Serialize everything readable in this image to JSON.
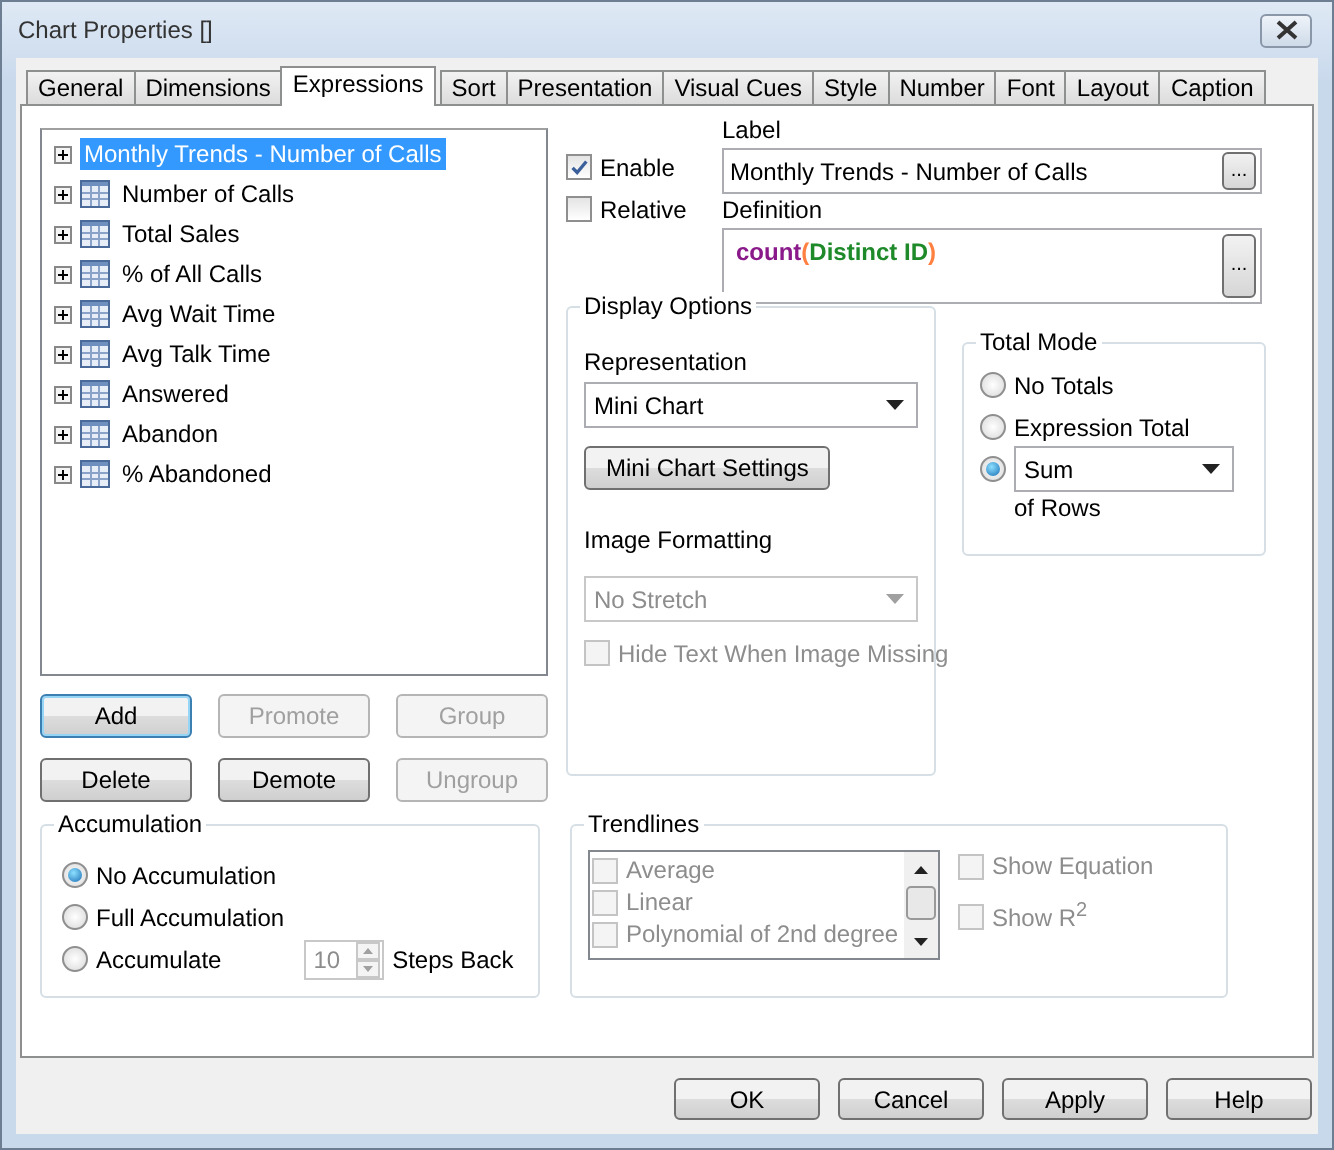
{
  "window": {
    "title": "Chart Properties []"
  },
  "tabs": [
    {
      "label": "General",
      "selected": false
    },
    {
      "label": "Dimensions",
      "selected": false
    },
    {
      "label": "Expressions",
      "selected": true
    },
    {
      "label": "Sort",
      "selected": false
    },
    {
      "label": "Presentation",
      "selected": false
    },
    {
      "label": "Visual Cues",
      "selected": false
    },
    {
      "label": "Style",
      "selected": false
    },
    {
      "label": "Number",
      "selected": false
    },
    {
      "label": "Font",
      "selected": false
    },
    {
      "label": "Layout",
      "selected": false
    },
    {
      "label": "Caption",
      "selected": false
    }
  ],
  "expressions": [
    {
      "label": "Monthly Trends - Number of Calls",
      "kind": "group",
      "selected": true
    },
    {
      "label": "Number of Calls",
      "kind": "expression",
      "selected": false
    },
    {
      "label": "Total Sales",
      "kind": "expression",
      "selected": false
    },
    {
      "label": "% of All Calls",
      "kind": "expression",
      "selected": false
    },
    {
      "label": "Avg Wait Time",
      "kind": "expression",
      "selected": false
    },
    {
      "label": "Avg Talk Time",
      "kind": "expression",
      "selected": false
    },
    {
      "label": "Answered",
      "kind": "expression",
      "selected": false
    },
    {
      "label": "Abandon",
      "kind": "expression",
      "selected": false
    },
    {
      "label": "% Abandoned",
      "kind": "expression",
      "selected": false
    }
  ],
  "list_buttons": [
    {
      "label": "Add",
      "disabled": false,
      "focused": true
    },
    {
      "label": "Promote",
      "disabled": true,
      "focused": false
    },
    {
      "label": "Group",
      "disabled": true,
      "focused": false
    },
    {
      "label": "Delete",
      "disabled": false,
      "focused": false
    },
    {
      "label": "Demote",
      "disabled": false,
      "focused": false
    },
    {
      "label": "Ungroup",
      "disabled": true,
      "focused": false
    }
  ],
  "options": [
    {
      "label": "Enable",
      "checked": true
    },
    {
      "label": "Relative",
      "checked": false
    }
  ],
  "label_field": {
    "caption": "Label",
    "value": "Monthly Trends - Number of Calls",
    "button": "..."
  },
  "definition": {
    "caption": "Definition",
    "button": "...",
    "segments": [
      {
        "text": "count",
        "kind": "function"
      },
      {
        "text": "(",
        "kind": "paren"
      },
      {
        "text": "Distinct ID",
        "kind": "field"
      },
      {
        "text": ")",
        "kind": "paren"
      }
    ]
  },
  "display_options": {
    "title": "Display Options",
    "representation_label": "Representation",
    "representation": "Mini Chart",
    "settings_button": "Mini Chart Settings",
    "image_formatting_label": "Image Formatting",
    "image_formatting": {
      "value": "No Stretch",
      "disabled": true
    },
    "hide_text": {
      "label": "Hide Text When Image Missing",
      "checked": false,
      "disabled": true
    }
  },
  "total_mode": {
    "title": "Total Mode",
    "options": [
      {
        "kind": "radio",
        "label": "No Totals",
        "selected": false
      },
      {
        "kind": "radio",
        "label": "Expression Total",
        "selected": false
      },
      {
        "kind": "dropdown",
        "value": "Sum",
        "selected": true
      }
    ],
    "suffix": "of Rows"
  },
  "accumulation": {
    "title": "Accumulation",
    "options": [
      {
        "label": "No Accumulation",
        "selected": true
      },
      {
        "label": "Full Accumulation",
        "selected": false
      },
      {
        "label": "Accumulate",
        "selected": false
      }
    ],
    "steps": "10",
    "steps_label": "Steps Back"
  },
  "trendlines": {
    "title": "Trendlines",
    "disabled": true,
    "items": [
      {
        "label": "Average",
        "checked": false
      },
      {
        "label": "Linear",
        "checked": false
      },
      {
        "label": "Polynomial of 2nd degree",
        "checked": false
      }
    ],
    "show_equation": {
      "label": "Show Equation",
      "checked": false
    },
    "show_r2": {
      "label": "Show R$^{2}$",
      "checked": false
    }
  },
  "footer_buttons": [
    {
      "label": "OK"
    },
    {
      "label": "Cancel"
    },
    {
      "label": "Apply"
    },
    {
      "label": "Help"
    }
  ]
}
